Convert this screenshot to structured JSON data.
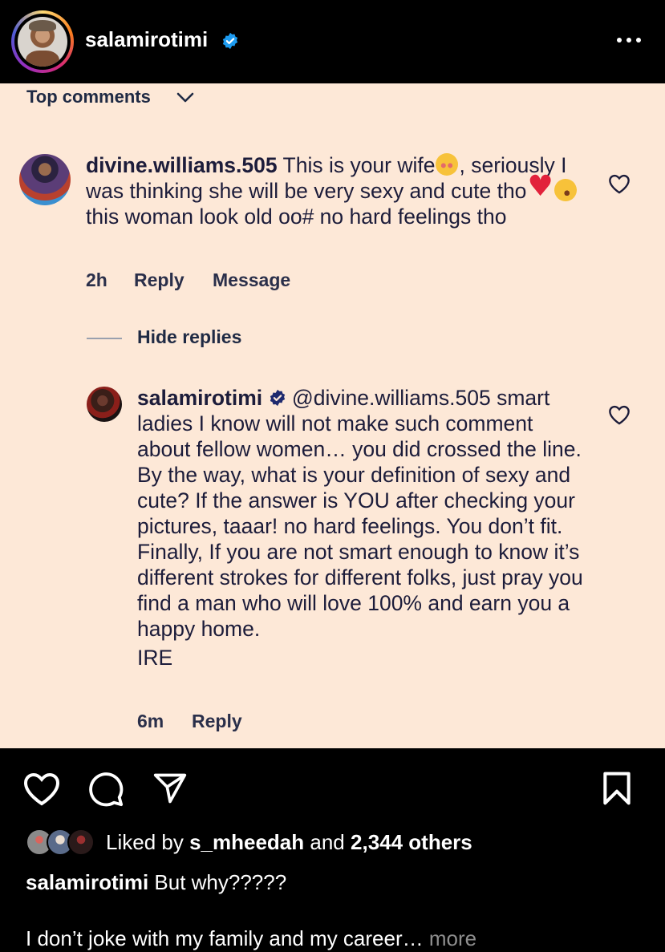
{
  "header": {
    "username": "salamirotimi",
    "verified_color": "#1d9bf0"
  },
  "comments_panel": {
    "sort_label": "Top comments",
    "background": "#fde8d7",
    "comments": [
      {
        "username": "divine.williams.505",
        "text_part1": "This is your wife",
        "text_part2": ", seriously I was thinking she will be very sexy and cute tho",
        "text_part3": "this woman look old oo# no hard feelings tho",
        "emojis": [
          "flushed-face-emoji",
          "red-heart-emoji",
          "rolling-on-floor-laughing-emoji"
        ],
        "time": "2h",
        "reply_label": "Reply",
        "message_label": "Message"
      }
    ],
    "hide_replies_label": "Hide replies",
    "replies": [
      {
        "username": "salamirotimi",
        "mention": "@divine.williams.505",
        "text": "smart ladies I know will not make such comment about fellow women… you did crossed the line.  By the way, what is your definition of sexy and cute? If the answer is YOU after checking your pictures, taaar! no hard feelings. You don’t fit. Finally, If you are not smart enough to know it’s different strokes for different folks, just pray you find a man who will love 100% and earn you a happy home.",
        "signoff": "IRE",
        "time": "6m",
        "reply_label": "Reply"
      }
    ]
  },
  "post_footer": {
    "liked_prefix": "Liked by",
    "liked_user": "s_mheedah",
    "liked_and": "and",
    "liked_others": "2,344 others",
    "caption_username": "salamirotimi",
    "caption_text": "But why?????",
    "caption_line2": "I don’t joke with my family and my career…",
    "more_label": "more"
  }
}
